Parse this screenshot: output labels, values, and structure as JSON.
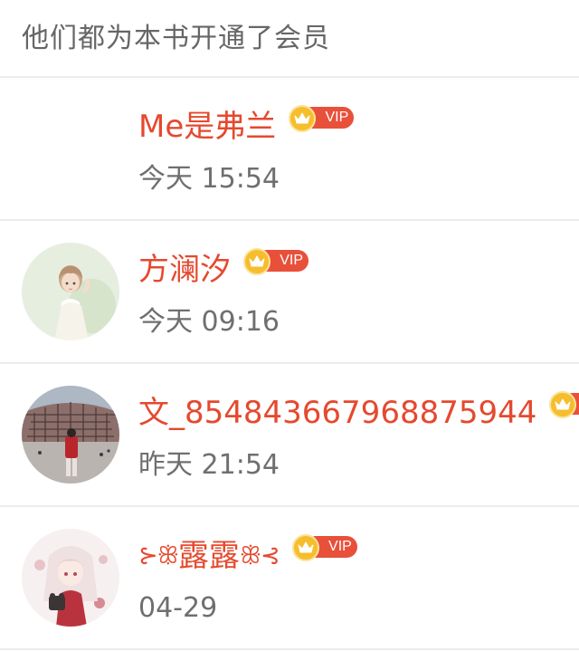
{
  "header": {
    "title": "他们都为本书开通了会员"
  },
  "vip_label": "VIP",
  "colors": {
    "name": "#e5492e",
    "vip_pill": "#e8503a",
    "crown": "#f6bd2d",
    "time": "#6f6f6f"
  },
  "members": [
    {
      "name": "Me是弗兰",
      "time": "今天 15:54",
      "avatar": "none"
    },
    {
      "name": "方澜汐",
      "time": "今天 09:16",
      "avatar": "girl-avatar"
    },
    {
      "name": "文_854843667968875944",
      "time": "昨天 21:54",
      "avatar": "stadium-photo-avatar"
    },
    {
      "name": "露露",
      "decor_left": "⊱ꕥ",
      "decor_right": "ꕥ⊰",
      "time": "04-29",
      "avatar": "anime-avatar"
    }
  ]
}
